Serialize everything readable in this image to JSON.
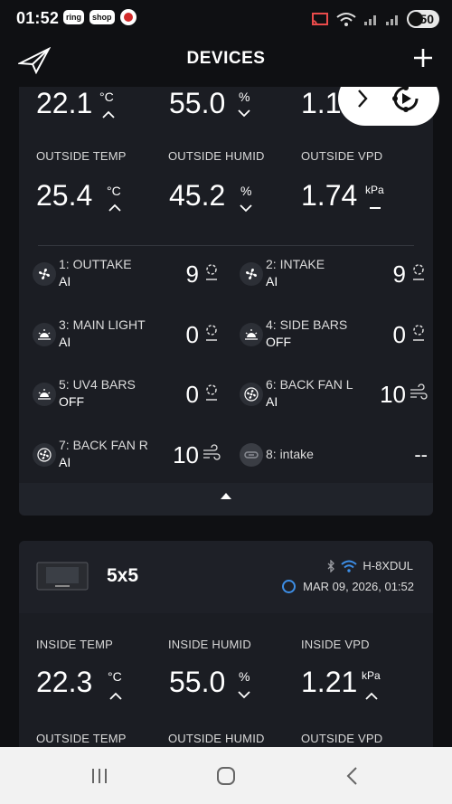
{
  "status_bar": {
    "time": "01:52",
    "app1": "ring",
    "app2": "shop",
    "battery": "50"
  },
  "header": {
    "title": "DEVICES"
  },
  "card1": {
    "inside": [
      {
        "value": "22.1",
        "unit": "°C"
      },
      {
        "value": "55.0",
        "unit": "%"
      },
      {
        "value": "1.19",
        "unit": ""
      }
    ],
    "outside": [
      {
        "label": "OUTSIDE TEMP",
        "value": "25.4",
        "unit": "°C"
      },
      {
        "label": "OUTSIDE HUMID",
        "value": "45.2",
        "unit": "%"
      },
      {
        "label": "OUTSIDE VPD",
        "value": "1.74",
        "unit": "kPa"
      }
    ],
    "ports": [
      {
        "name": "1: OUTTAKE",
        "mode": "AI",
        "level": "9",
        "icon": "fan-icon"
      },
      {
        "name": "2: INTAKE",
        "mode": "AI",
        "level": "9",
        "icon": "fan-icon"
      },
      {
        "name": "3: MAIN LIGHT",
        "mode": "AI",
        "level": "0",
        "icon": "grow-light-icon"
      },
      {
        "name": "4: SIDE BARS",
        "mode": "OFF",
        "level": "0",
        "icon": "grow-light-icon"
      },
      {
        "name": "5: UV4 BARS",
        "mode": "OFF",
        "level": "0",
        "icon": "grow-light-icon"
      },
      {
        "name": "6: BACK FAN L",
        "mode": "AI",
        "level": "10",
        "icon": "fan-icon"
      },
      {
        "name": "7: BACK FAN R",
        "mode": "AI",
        "level": "10",
        "icon": "fan-icon"
      },
      {
        "name": "8: intake",
        "mode": "",
        "level": "--",
        "icon": "plug-icon"
      }
    ]
  },
  "card2": {
    "name": "5x5",
    "connection": "H-8XDUL",
    "timestamp": "MAR 09, 2026, 01:52",
    "inside": [
      {
        "label": "INSIDE TEMP",
        "value": "22.3",
        "unit": "°C"
      },
      {
        "label": "INSIDE HUMID",
        "value": "55.0",
        "unit": "%"
      },
      {
        "label": "INSIDE VPD",
        "value": "1.21",
        "unit": "kPa"
      }
    ],
    "outside_labels": [
      "OUTSIDE TEMP",
      "OUTSIDE HUMID",
      "OUTSIDE VPD"
    ]
  },
  "colors": {
    "background": "#0f1013",
    "card": "#1b1d23",
    "accent_blue": "#3d8ee6"
  }
}
